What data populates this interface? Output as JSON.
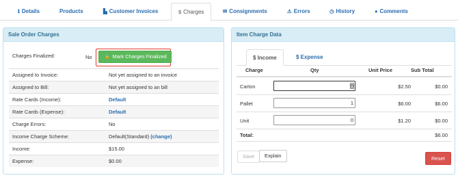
{
  "tabs": [
    {
      "label": "Details",
      "icon": "info-icon"
    },
    {
      "label": "Products"
    },
    {
      "label": "Customer Invoices",
      "icon": "document-icon"
    },
    {
      "label": "Charges",
      "icon": "dollar-icon",
      "active": true
    },
    {
      "label": "Consignments",
      "icon": "envelope-icon"
    },
    {
      "label": "Errors",
      "icon": "warning-icon"
    },
    {
      "label": "History",
      "icon": "clock-icon"
    },
    {
      "label": "Comments",
      "icon": "comment-icon"
    }
  ],
  "left": {
    "title": "Sale Order Charges",
    "finalized_label": "Charges Finalized:",
    "finalized_value": "No",
    "mark_button": "Mark Charges Finalized",
    "rows": [
      {
        "label": "Assigned to Invoice:",
        "value": "Not yet assigned to an invoice"
      },
      {
        "label": "Assigned to Bill:",
        "value": "Not yet assigned to an bill"
      },
      {
        "label": "Rate Cards (Income):",
        "value": "Default"
      },
      {
        "label": "Rate Cards (Expense):",
        "value": "Default"
      },
      {
        "label": "Charge Errors:",
        "value": "No"
      },
      {
        "label": "Income Charge Scheme:",
        "value": "Default(Standard)",
        "link": "(change)"
      },
      {
        "label": "Income:",
        "value": "$15.00"
      },
      {
        "label": "Expense:",
        "value": "$0.00"
      }
    ]
  },
  "right": {
    "title": "Item Charge Data",
    "subtabs": [
      "Income",
      "Expense"
    ],
    "headers": [
      "Charge",
      "Qty",
      "Unit Price",
      "Sub Total"
    ],
    "rows": [
      {
        "charge": "Carton",
        "qty": "0",
        "unit_price": "$2.50",
        "sub_total": "$0.00"
      },
      {
        "charge": "Pallet",
        "qty": "1",
        "unit_price": "$6.00",
        "sub_total": "$6.00"
      },
      {
        "charge": "Unit",
        "qty": "0",
        "unit_price": "$1.20",
        "sub_total": "$0.00"
      }
    ],
    "total_label": "Total:",
    "total_value": "$6.00",
    "save": "Save",
    "explain": "Explain",
    "reset": "Reset"
  },
  "colors": {
    "accent": "#2a6db0",
    "panel_header": "#d9edf7",
    "success": "#5cb85c",
    "danger": "#d9534f",
    "highlight_border": "#e0392b"
  }
}
